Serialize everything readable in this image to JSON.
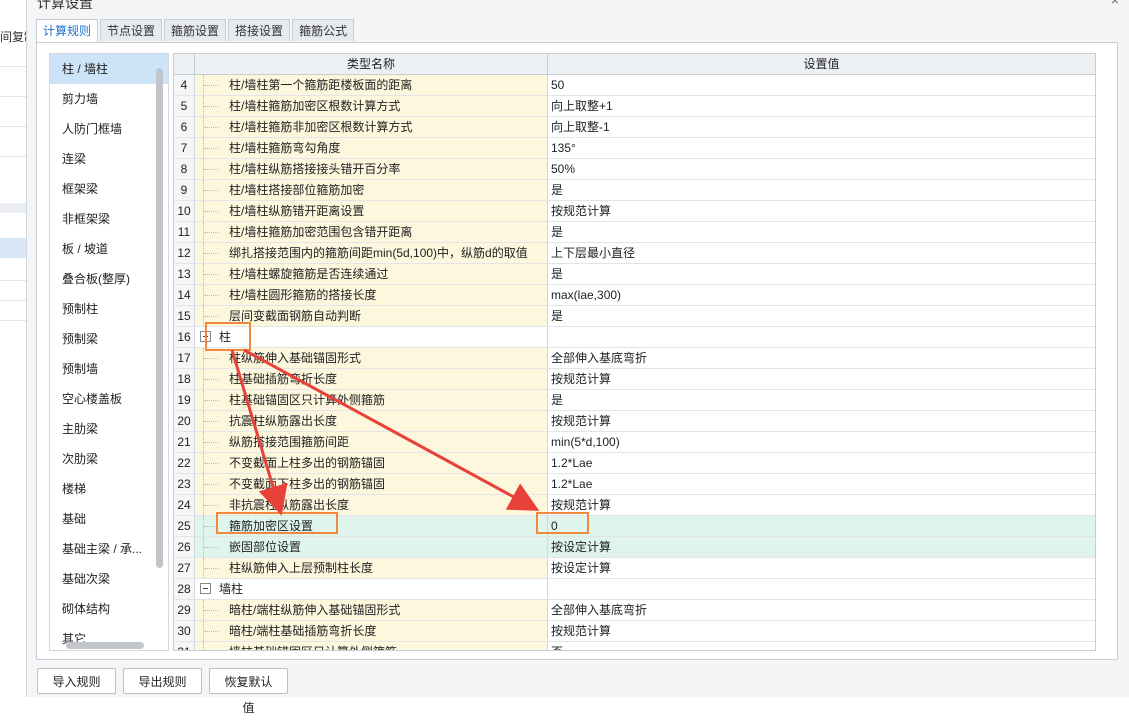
{
  "left_fragment": "间复制",
  "dialog": {
    "title": "计算设置",
    "close": "×"
  },
  "tabs": [
    {
      "label": "计算规则",
      "active": true
    },
    {
      "label": "节点设置",
      "active": false
    },
    {
      "label": "箍筋设置",
      "active": false
    },
    {
      "label": "搭接设置",
      "active": false
    },
    {
      "label": "箍筋公式",
      "active": false
    }
  ],
  "categories": [
    "柱 / 墙柱",
    "剪力墙",
    "人防门框墙",
    "连梁",
    "框架梁",
    "非框架梁",
    "板 / 坡道",
    "叠合板(整厚)",
    "预制柱",
    "预制梁",
    "预制墙",
    "空心楼盖板",
    "主肋梁",
    "次肋梁",
    "楼梯",
    "基础",
    "基础主梁 / 承...",
    "基础次梁",
    "砌体结构",
    "其它"
  ],
  "selected_category": "柱 / 墙柱",
  "table": {
    "headers": {
      "name": "类型名称",
      "value": "设置值"
    },
    "rows": [
      {
        "num": "4",
        "name": "柱/墙柱第一个箍筋距楼板面的距离",
        "value": "50"
      },
      {
        "num": "5",
        "name": "柱/墙柱箍筋加密区根数计算方式",
        "value": "向上取整+1"
      },
      {
        "num": "6",
        "name": "柱/墙柱箍筋非加密区根数计算方式",
        "value": "向上取整-1"
      },
      {
        "num": "7",
        "name": "柱/墙柱箍筋弯勾角度",
        "value": "135°"
      },
      {
        "num": "8",
        "name": "柱/墙柱纵筋搭接接头错开百分率",
        "value": "50%"
      },
      {
        "num": "9",
        "name": "柱/墙柱搭接部位箍筋加密",
        "value": "是"
      },
      {
        "num": "10",
        "name": "柱/墙柱纵筋错开距离设置",
        "value": "按规范计算"
      },
      {
        "num": "11",
        "name": "柱/墙柱箍筋加密范围包含错开距离",
        "value": "是"
      },
      {
        "num": "12",
        "name": "绑扎搭接范围内的箍筋间距min(5d,100)中，纵筋d的取值",
        "value": "上下层最小直径"
      },
      {
        "num": "13",
        "name": "柱/墙柱螺旋箍筋是否连续通过",
        "value": "是"
      },
      {
        "num": "14",
        "name": "柱/墙柱圆形箍筋的搭接长度",
        "value": "max(lae,300)"
      },
      {
        "num": "15",
        "name": "层间变截面钢筋自动判断",
        "value": "是"
      },
      {
        "num": "16",
        "name": "柱",
        "value": "",
        "group": true
      },
      {
        "num": "17",
        "name": "柱纵筋伸入基础锚固形式",
        "value": "全部伸入基底弯折"
      },
      {
        "num": "18",
        "name": "柱基础插筋弯折长度",
        "value": "按规范计算"
      },
      {
        "num": "19",
        "name": "柱基础锚固区只计算外侧箍筋",
        "value": "是"
      },
      {
        "num": "20",
        "name": "抗震柱纵筋露出长度",
        "value": "按规范计算"
      },
      {
        "num": "21",
        "name": "纵筋搭接范围箍筋间距",
        "value": "min(5*d,100)"
      },
      {
        "num": "22",
        "name": "不变截面上柱多出的钢筋锚固",
        "value": "1.2*Lae"
      },
      {
        "num": "23",
        "name": "不变截面下柱多出的钢筋锚固",
        "value": "1.2*Lae"
      },
      {
        "num": "24",
        "name": "非抗震柱纵筋露出长度",
        "value": "按规范计算"
      },
      {
        "num": "25",
        "name": "箍筋加密区设置",
        "value": "0",
        "highlight": true
      },
      {
        "num": "26",
        "name": "嵌固部位设置",
        "value": "按设定计算",
        "highlight": true
      },
      {
        "num": "27",
        "name": "柱纵筋伸入上层预制柱长度",
        "value": "按设定计算"
      },
      {
        "num": "28",
        "name": "墙柱",
        "value": "",
        "group": true
      },
      {
        "num": "29",
        "name": "暗柱/端柱纵筋伸入基础锚固形式",
        "value": "全部伸入基底弯折"
      },
      {
        "num": "30",
        "name": "暗柱/端柱基础插筋弯折长度",
        "value": "按规范计算"
      },
      {
        "num": "31",
        "name": "墙柱基础锚固区只计算外侧箍筋",
        "value": "否"
      }
    ]
  },
  "buttons": {
    "import": "导入规则",
    "export": "导出规则",
    "restore": "恢复默认值"
  },
  "colors": {
    "annotation": "#f0883e",
    "arrow": "#e8413a",
    "active_tab": "#1e6fd0",
    "name_cell_bg": "#fdf7dd",
    "highlight_bg": "#dff5ec"
  }
}
